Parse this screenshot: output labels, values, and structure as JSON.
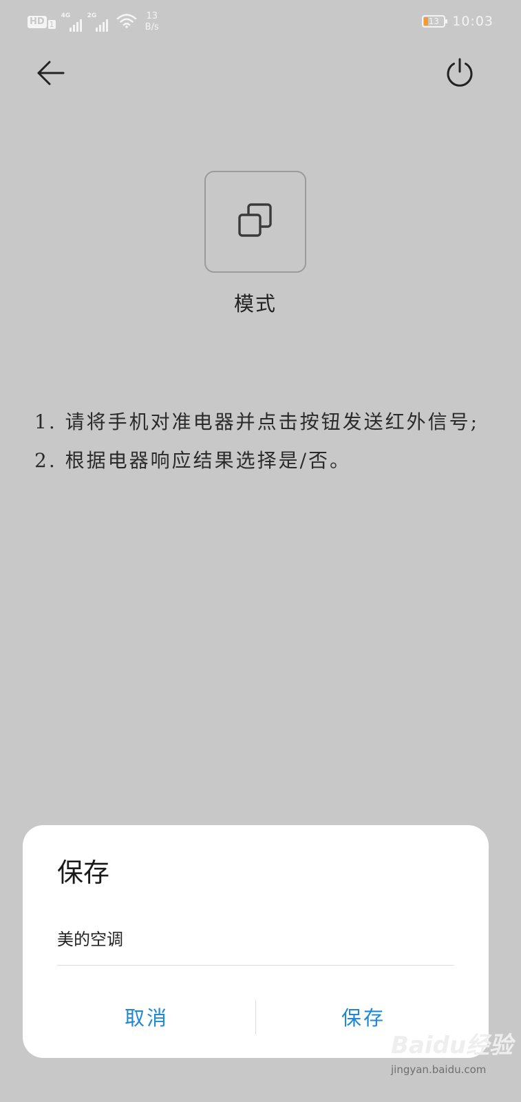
{
  "status_bar": {
    "hd": "HD",
    "sim": "1",
    "net1": "4G",
    "net2": "2G",
    "speed_value": "13",
    "speed_unit": "B/s",
    "battery": "13",
    "time": "10:03"
  },
  "toolbar": {
    "back_icon": "arrow-left-icon",
    "power_icon": "power-icon"
  },
  "mode": {
    "icon": "mode-icon",
    "label": "模式"
  },
  "instructions": [
    "1. 请将手机对准电器并点击按钮发送红外信号;",
    "2. 根据电器响应结果选择是/否。"
  ],
  "dialog": {
    "title": "保存",
    "name_value": "美的空调",
    "cancel_label": "取消",
    "save_label": "保存"
  },
  "watermark": {
    "logo": "Baidu经验",
    "url": "jingyan.baidu.com"
  },
  "colors": {
    "background": "#c8c8c8",
    "accent": "#1e88d6",
    "battery_low": "#f29b30"
  }
}
